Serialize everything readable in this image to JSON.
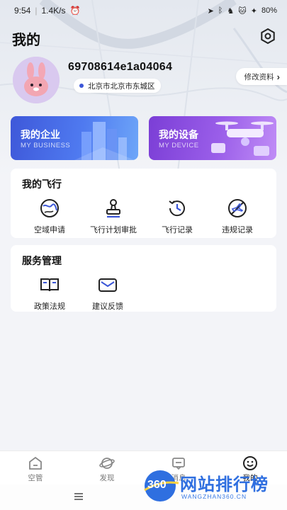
{
  "status_bar": {
    "time": "9:54",
    "speed": "1.4K/s",
    "battery": "80%"
  },
  "header": {
    "title": "我的"
  },
  "profile": {
    "user_id": "69708614e1a04064",
    "location": "北京市北京市东城区",
    "edit_label": "修改资料"
  },
  "banners": [
    {
      "title": "我的企业",
      "subtitle": "MY BUSINESS"
    },
    {
      "title": "我的设备",
      "subtitle": "MY DEVICE"
    }
  ],
  "flight_section": {
    "title": "我的飞行",
    "items": [
      {
        "label": "空域申请",
        "icon": "globe-route-icon"
      },
      {
        "label": "飞行计划审批",
        "icon": "stamp-icon"
      },
      {
        "label": "飞行记录",
        "icon": "history-icon"
      },
      {
        "label": "违规记录",
        "icon": "no-fly-icon"
      }
    ]
  },
  "service_section": {
    "title": "服务管理",
    "items": [
      {
        "label": "政策法规",
        "icon": "book-icon"
      },
      {
        "label": "建议反馈",
        "icon": "mail-icon"
      }
    ]
  },
  "bottom_nav": [
    {
      "label": "空管",
      "icon": "home-icon"
    },
    {
      "label": "发现",
      "icon": "planet-icon"
    },
    {
      "label": "消息",
      "icon": "message-icon"
    },
    {
      "label": "我的",
      "icon": "smile-icon",
      "active": true
    }
  ],
  "watermark": {
    "badge": "360",
    "text": "网站排行榜",
    "sub": "WANGZHAN360.CN"
  },
  "colors": {
    "accent": "#3c57d8",
    "business_banner": "#4f7af0",
    "device_banner": "#9a5ee9",
    "watermark": "#2f6fe0"
  }
}
